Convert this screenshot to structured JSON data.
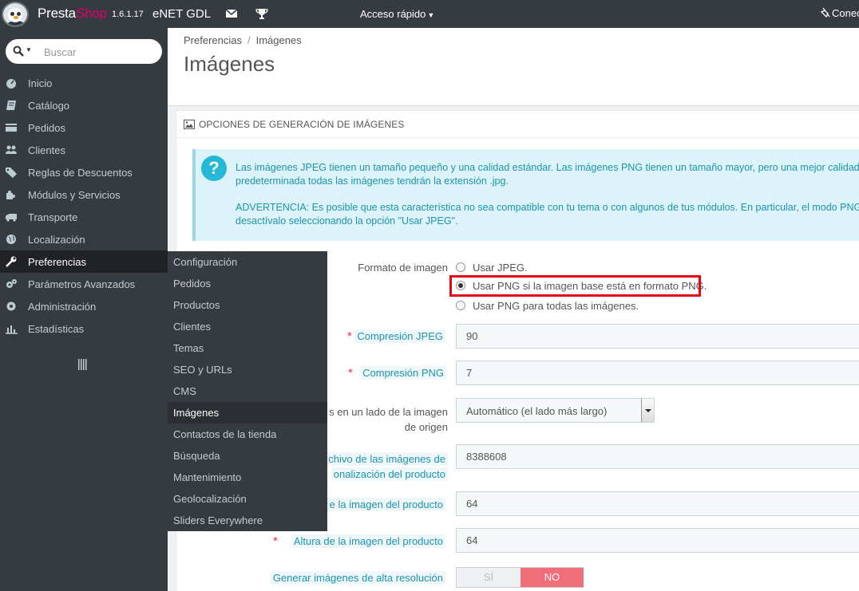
{
  "topbar": {
    "brand_presta": "Presta",
    "brand_shop": "Shop",
    "version": "1.6.1.17",
    "shop_name": "eNET GDL",
    "quick_access": "Acceso rápido",
    "connect": "Conec"
  },
  "search": {
    "placeholder": "Buscar"
  },
  "sidebar": {
    "items": [
      {
        "label": "Inicio",
        "icon": "home-icon"
      },
      {
        "label": "Catálogo",
        "icon": "book-icon"
      },
      {
        "label": "Pedidos",
        "icon": "credit-card-icon"
      },
      {
        "label": "Clientes",
        "icon": "users-icon"
      },
      {
        "label": "Reglas de Descuentos",
        "icon": "tag-icon"
      },
      {
        "label": "Módulos y Servicios",
        "icon": "puzzle-icon"
      },
      {
        "label": "Transporte",
        "icon": "truck-icon"
      },
      {
        "label": "Localización",
        "icon": "globe-icon"
      },
      {
        "label": "Preferencias",
        "icon": "wrench-icon"
      },
      {
        "label": "Parámetros Avanzados",
        "icon": "cogs-icon"
      },
      {
        "label": "Administración",
        "icon": "cog-icon"
      },
      {
        "label": "Estadísticas",
        "icon": "bar-chart-icon"
      }
    ]
  },
  "submenu": {
    "items": [
      "Configuración",
      "Pedidos",
      "Productos",
      "Clientes",
      "Temas",
      "SEO y URLs",
      "CMS",
      "Imágenes",
      "Contactos de la tienda",
      "Búsqueda",
      "Mantenimiento",
      "Geolocalización",
      "Sliders Everywhere"
    ]
  },
  "breadcrumb": {
    "parent": "Preferencias",
    "separator": "/",
    "current": "Imágenes"
  },
  "page_title": "Imágenes",
  "panel": {
    "heading": "OPCIONES DE GENERACIÓN DE IMÁGENES",
    "alert_line1": "Las imágenes JPEG tienen un tamaño pequeño y una calidad estándar. Las imágenes PNG tienen un tamaño mayor, pero una mejor calidad",
    "alert_line2": "predeterminada todas las imágenes tendrán la extensión .jpg.",
    "alert_line3": "ADVERTENCIA: Es posible que esta característica no sea compatible con tu tema o con algunos de tus módulos. En particular, el modo PNG n",
    "alert_line4": "desactívalo seleccionando la opción \"Usar JPEG\"."
  },
  "form": {
    "format_label": "Formato de imagen",
    "format_options": [
      "Usar JPEG.",
      "Usar PNG si la imagen base está en formato PNG.",
      "Usar PNG para todas las imágenes."
    ],
    "jpeg_label": "Compresión JPEG",
    "jpeg_value": "90",
    "png_label": "Compresión PNG",
    "png_value": "7",
    "side_label_1": "s en un lado de la imagen",
    "side_label_2": "de origen",
    "side_value": "Automático (el lado más largo)",
    "filesize_label_1": "chivo de las imágenes de",
    "filesize_label_2": "onalización del producto",
    "filesize_value": "8388608",
    "width_label": "e la imagen del producto",
    "width_value": "64",
    "height_label": "Altura de la imagen del producto",
    "height_value": "64",
    "hires_label": "Generar imágenes de alta resolución",
    "hires_yes": "SÍ",
    "hires_no": "NO"
  },
  "colors": {
    "accent": "#25b9d7",
    "brand_pink": "#df0067",
    "highlight_red": "#e30613",
    "toggle_no": "#f06d7a"
  }
}
